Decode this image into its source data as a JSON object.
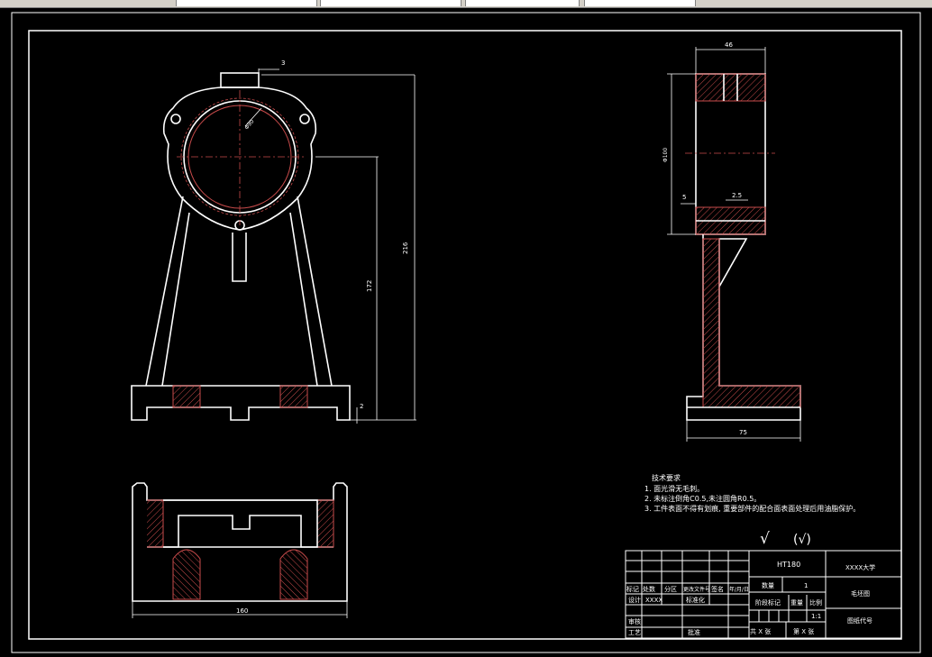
{
  "dims": {
    "front_width_top": "3",
    "front_height_total": "216",
    "front_height_center": "172",
    "front_base_step": "2",
    "bore_dia": "Φ90",
    "bottom_width": "160",
    "side_width": "46",
    "side_height": "Φ100",
    "side_flange_left": "5",
    "side_flange_right": "2.5",
    "side_base_width": "75"
  },
  "tech": {
    "title": "技术要求",
    "lines": [
      "1. 面光滑无毛刺。",
      "2. 未标注倒角C0.5,未注圆角R0.5。",
      "3. 工件表面不得有划痕, 重要部件的配合面表面处理后用油脂保护。"
    ]
  },
  "roughness": {
    "main": "√",
    "other": "(√)"
  },
  "title_block": {
    "material": "HT180",
    "school": "XXXX大学",
    "qty_label": "数量",
    "qty_value": "1",
    "drawing_name": "毛坯图",
    "stage_label": "阶段标记",
    "weight_label": "重量",
    "scale_label": "比例",
    "scale_value": "1:1",
    "drawing_code": "图纸代号",
    "sheets_total": "共 X 张",
    "sheet_no": "第 X 张",
    "mark": "标记",
    "count": "处数",
    "zone": "分区",
    "change_doc": "更改文件号",
    "sign": "签名",
    "date": "年/月/日",
    "design": "设计",
    "designer": "XXXX",
    "standardize": "标准化",
    "review": "审核",
    "process": "工艺",
    "approve": "批准"
  }
}
